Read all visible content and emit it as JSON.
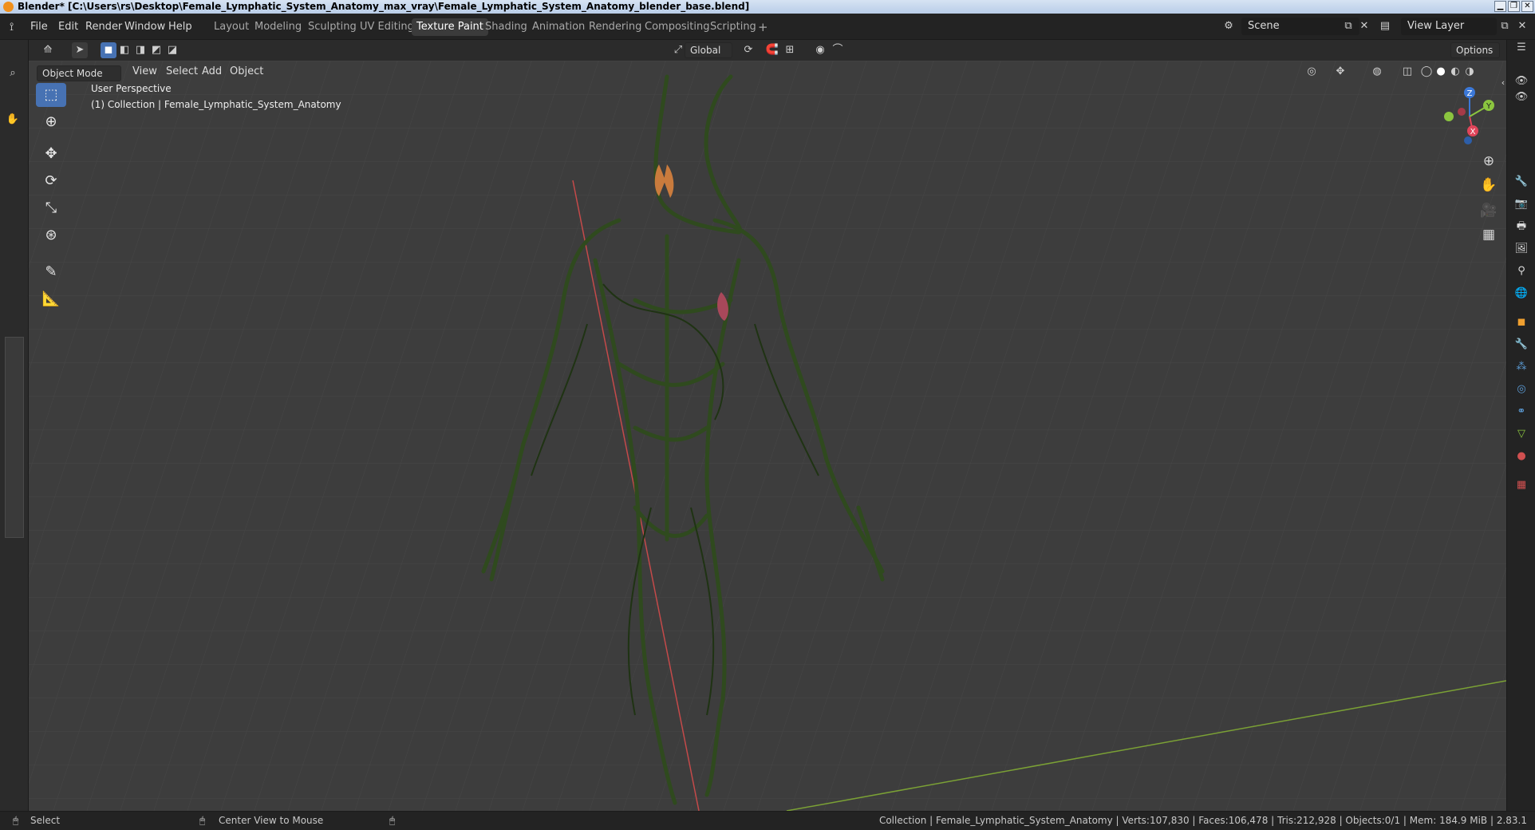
{
  "window": {
    "title": "Blender* [C:\\Users\\rs\\Desktop\\Female_Lymphatic_System_Anatomy_max_vray\\Female_Lymphatic_System_Anatomy_blender_base.blend]",
    "min": "▁",
    "max": "❐",
    "close": "✕"
  },
  "menu": {
    "file": "File",
    "edit": "Edit",
    "render": "Render",
    "window": "Window",
    "help": "Help"
  },
  "workspaces": [
    "Layout",
    "Modeling",
    "Sculpting",
    "UV Editing",
    "Texture Paint",
    "Shading",
    "Animation",
    "Rendering",
    "Compositing",
    "Scripting"
  ],
  "active_workspace": "Texture Paint",
  "add_workspace": "+",
  "scene": {
    "label": "Scene",
    "view_layer": "View Layer"
  },
  "tool_header": {
    "orientation": "Global",
    "options": "Options"
  },
  "viewport_header": {
    "mode": "Object Mode",
    "view": "View",
    "select": "Select",
    "add": "Add",
    "object": "Object"
  },
  "viewport": {
    "perspective": "User Perspective",
    "collection": "(1) Collection | Female_Lymphatic_System_Anatomy"
  },
  "gizmo": {
    "z": "Z",
    "y": "Y",
    "x": "X",
    "color_x": "#e0455a",
    "color_y": "#8bc53f",
    "color_z": "#3b78d8"
  },
  "statusbar": {
    "select": "Select",
    "center_view": "Center View to Mouse",
    "info": "Collection | Female_Lymphatic_System_Anatomy | Verts:107,830 | Faces:106,478 | Tris:212,928 | Objects:0/1 | Mem: 184.9 MiB | 2.83.1"
  },
  "colors": {
    "accent": "#4772b3",
    "grid_x": "#c44a4a",
    "grid_y": "#7ba135",
    "lymph": "#2f4a1e"
  }
}
